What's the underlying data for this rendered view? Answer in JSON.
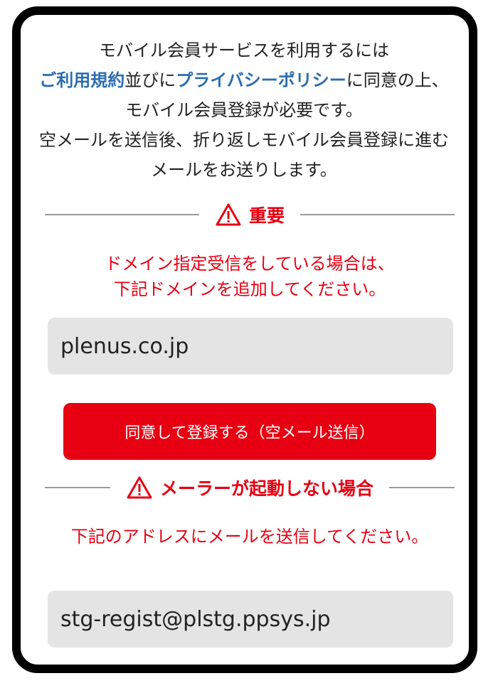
{
  "intro": {
    "text_before_link1": "モバイル会員サービスを利用するには",
    "link_terms": "ご利用規約",
    "text_between_links": "並びに",
    "link_privacy": "プライバシーポリシー",
    "text_after_links": "に同意の上、モバイル会員登録が必要です。",
    "text_second": "空メールを送信後、折り返しモバイル会員登録に進むメールをお送りします。"
  },
  "important": {
    "heading": "重要",
    "notice_line1": "ドメイン指定受信をしている場合は、",
    "notice_line2": "下記ドメインを追加してください。",
    "domain": "plenus.co.jp"
  },
  "register_button_label": "同意して登録する（空メール送信）",
  "mailer": {
    "heading": "メーラーが起動しない場合",
    "notice": "下記のアドレスにメールを送信してください。",
    "address": "stg-regist@plstg.ppsys.jp"
  },
  "colors": {
    "accent_red": "#e60012",
    "link_blue": "#2b6db0",
    "field_bg": "#e4e4e4"
  },
  "icons": {
    "warning": "warning-triangle-icon"
  }
}
